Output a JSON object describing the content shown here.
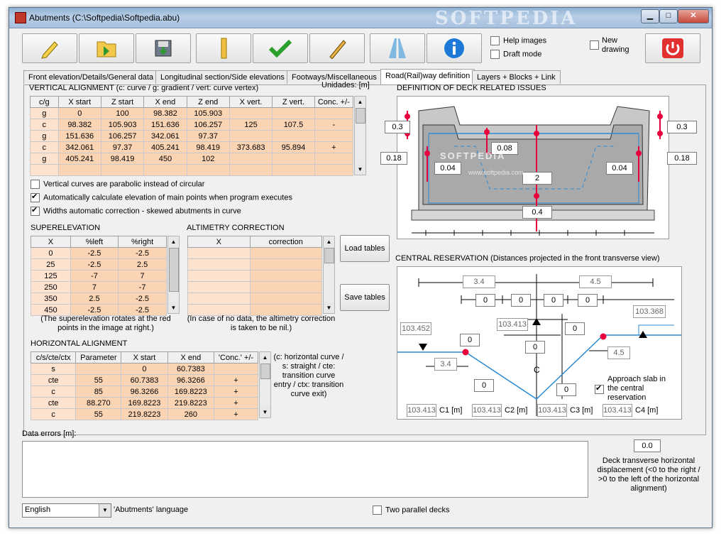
{
  "window": {
    "title": "Abutments (C:\\Softpedia\\Softpedia.abu)",
    "watermark": "SOFTPEDIA"
  },
  "titlebar_buttons": {
    "minimize": "▁",
    "maximize": "□",
    "close": "✕"
  },
  "toolbar": {
    "buttons": [
      "edit-icon",
      "open-folder-icon",
      "save-icon",
      "ruler-icon",
      "check-icon",
      "pencil-icon",
      "road-icon",
      "info-icon",
      "power-icon"
    ],
    "help_images_label": "Help images",
    "draft_mode_label": "Draft mode",
    "new_drawing_label": "New drawing"
  },
  "tabs": [
    "Front elevation/Details/General data",
    "Longitudinal section/Side elevations",
    "Footways/Miscellaneous",
    "Road(Rail)way definition",
    "Layers + Blocks + Link"
  ],
  "vertical_alignment": {
    "title": "VERTICAL ALIGNMENT (c: curve / g: gradient / vert: curve vertex)",
    "units": "Unidades: [m]",
    "headers": [
      "c/g",
      "X start",
      "Z start",
      "X end",
      "Z end",
      "X vert.",
      "Z vert.",
      "Conc. +/-"
    ],
    "rows": [
      [
        "g",
        "0",
        "100",
        "98.382",
        "105.903",
        "",
        "",
        ""
      ],
      [
        "c",
        "98.382",
        "105.903",
        "151.636",
        "106.257",
        "125",
        "107.5",
        "-"
      ],
      [
        "g",
        "151.636",
        "106.257",
        "342.061",
        "97.37",
        "",
        "",
        ""
      ],
      [
        "c",
        "342.061",
        "97.37",
        "405.241",
        "98.419",
        "373.683",
        "95.894",
        "+"
      ],
      [
        "g",
        "405.241",
        "98.419",
        "450",
        "102",
        "",
        "",
        ""
      ],
      [
        "",
        "",
        "",
        "",
        "",
        "",
        "",
        ""
      ]
    ]
  },
  "options": {
    "parabolic": "Vertical curves are parabolic instead of circular",
    "auto_elevation": "Automatically calculate elevation of main points when program executes",
    "width_correction": "Widths automatic correction - skewed abutments in curve"
  },
  "superelevation": {
    "title": "SUPERELEVATION",
    "headers": [
      "X",
      "%left",
      "%right"
    ],
    "rows": [
      [
        "0",
        "-2.5",
        "-2.5"
      ],
      [
        "25",
        "-2.5",
        "2.5"
      ],
      [
        "125",
        "-7",
        "7"
      ],
      [
        "250",
        "7",
        "-7"
      ],
      [
        "350",
        "2.5",
        "-2.5"
      ],
      [
        "450",
        "-2.5",
        "-2.5"
      ]
    ],
    "note": "(The superelevation rotates at the red points in the image at right.)"
  },
  "altimetry": {
    "title": "ALTIMETRY CORRECTION",
    "headers": [
      "X",
      "correction"
    ],
    "rows": [
      [
        "",
        ""
      ],
      [
        "",
        ""
      ],
      [
        "",
        ""
      ],
      [
        "",
        ""
      ],
      [
        "",
        ""
      ],
      [
        "",
        ""
      ]
    ],
    "note": "(In case of no data, the  altimetry correction is taken to be nil.)"
  },
  "load_tables": "Load tables",
  "save_tables": "Save tables",
  "horizontal_alignment": {
    "title": "HORIZONTAL ALIGNMENT",
    "headers": [
      "c/s/cte/ctx",
      "Parameter",
      "X start",
      "X end",
      "'Conc.' +/-"
    ],
    "rows": [
      [
        "s",
        "",
        "0",
        "60.7383",
        ""
      ],
      [
        "cte",
        "55",
        "60.7383",
        "96.3266",
        "+"
      ],
      [
        "c",
        "85",
        "96.3266",
        "169.8223",
        "+"
      ],
      [
        "cte",
        "88.270",
        "169.8223",
        "219.8223",
        "+"
      ],
      [
        "c",
        "55",
        "219.8223",
        "260",
        "+"
      ]
    ],
    "note": "(c: horizontal curve / s: straight / cte: transition curve entry / ctx: transition curve exit)"
  },
  "deck": {
    "title": "DEFINITION OF DECK RELATED ISSUES",
    "left_top": "0.3",
    "right_top": "0.3",
    "left_mid": "0.18",
    "right_mid": "0.18",
    "inner_top": "0.08",
    "left_inner": "0.04",
    "right_inner": "0.04",
    "center": "2",
    "bottom": "0.4",
    "softpedia_watermark": "SOFTPEDIA",
    "softpedia_url": "www.softpedia.com"
  },
  "central": {
    "title": "CENTRAL RESERVATION (Distances projected in the front transverse view)",
    "top_left": "3.4",
    "top_right": "4.5",
    "zero_values": [
      "0",
      "0",
      "0",
      "0"
    ],
    "elev_left": "103.452",
    "elev_mid": "103.413",
    "elev_right": "103.368",
    "mid_zero_1": "0",
    "mid_zero_2": "0",
    "mid_zero_3": "0",
    "low_zero_1": "0",
    "low_zero_2": "0",
    "lower_left": "3.4",
    "lower_right": "4.5",
    "c_label": "C",
    "approach_label": "Approach slab in the central reservation",
    "c_values": [
      {
        "value": "103.413",
        "label": "C1 [m]"
      },
      {
        "value": "103.413",
        "label": "C2 [m]"
      },
      {
        "value": "103.413",
        "label": "C3 [m]"
      },
      {
        "value": "103.413",
        "label": "C4 [m]"
      }
    ]
  },
  "data_errors_label": "Data errors [m]:",
  "deck_displacement": {
    "value": "0.0",
    "label": "Deck transverse horizontal displacement (<0 to the right / >0 to the left of the horizontal alignment)"
  },
  "language": {
    "value": "English",
    "label": "'Abutments' language"
  },
  "two_decks": "Two parallel decks",
  "colors": {
    "cell": "#fbd4b4",
    "accent": "#e8003c"
  }
}
